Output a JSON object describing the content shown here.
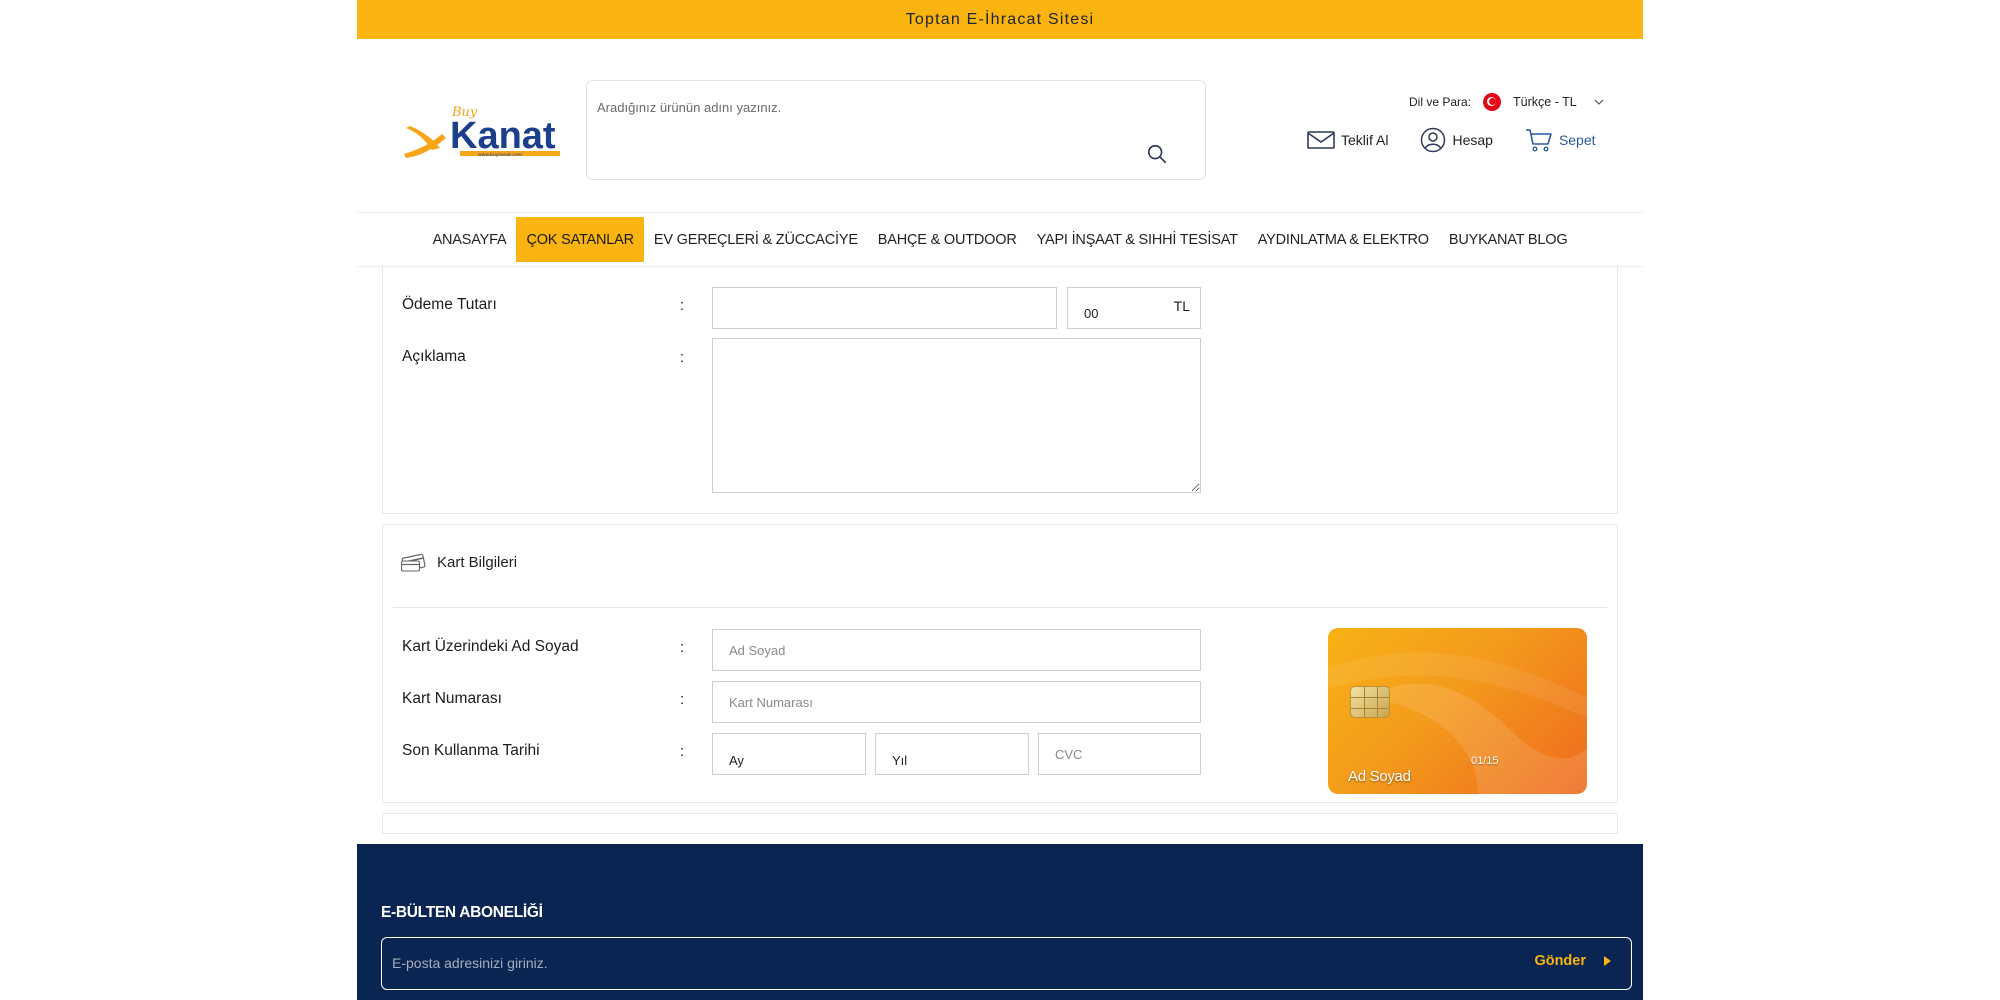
{
  "topbar": {
    "text": "Toptan E-İhracat Sitesi"
  },
  "header": {
    "logo_text": "Kanat",
    "logo_small": "Buy",
    "logo_url_text": "www.buykanat.com",
    "search_placeholder": "Aradığınız ürünün adını yazınız.",
    "lang_label": "Dil ve Para:",
    "lang_value": "Türkçe - TL",
    "links": {
      "quote": "Teklif Al",
      "account": "Hesap",
      "cart": "Sepet"
    }
  },
  "nav": {
    "items": [
      {
        "label": "ANASAYFA"
      },
      {
        "label": "ÇOK SATANLAR"
      },
      {
        "label": "EV GEREÇLERİ & ZÜCCACİYE"
      },
      {
        "label": "BAHÇE & OUTDOOR"
      },
      {
        "label": "YAPI İNŞAAT & SIHHİ TESİSAT"
      },
      {
        "label": "AYDINLATMA & ELEKTRO"
      },
      {
        "label": "BUYKANAT BLOG"
      }
    ],
    "active_index": 1
  },
  "payment": {
    "amount_label": "Ödeme Tutarı",
    "amount_value": "",
    "cents_value": "00",
    "currency": "TL",
    "description_label": "Açıklama",
    "description_value": "",
    "colon": ":"
  },
  "card": {
    "section_title": "Kart Bilgileri",
    "name_label": "Kart Üzerindeki Ad Soyad",
    "name_placeholder": "Ad Soyad",
    "number_label": "Kart Numarası",
    "number_placeholder": "Kart Numarası",
    "expiry_label": "Son Kullanma Tarihi",
    "month_value": "Ay",
    "year_value": "Yıl",
    "cvc_placeholder": "CVC",
    "preview_name": "Ad Soyad",
    "preview_expiry": "01/15"
  },
  "footer": {
    "newsletter_title": "E-BÜLTEN ABONELİĞİ",
    "email_placeholder": "E-posta adresinizi giriniz.",
    "submit_label": "Gönder"
  },
  "colors": {
    "accent": "#f9b410",
    "footer_bg": "#0b2553",
    "cart_link": "#2b5a9c"
  }
}
